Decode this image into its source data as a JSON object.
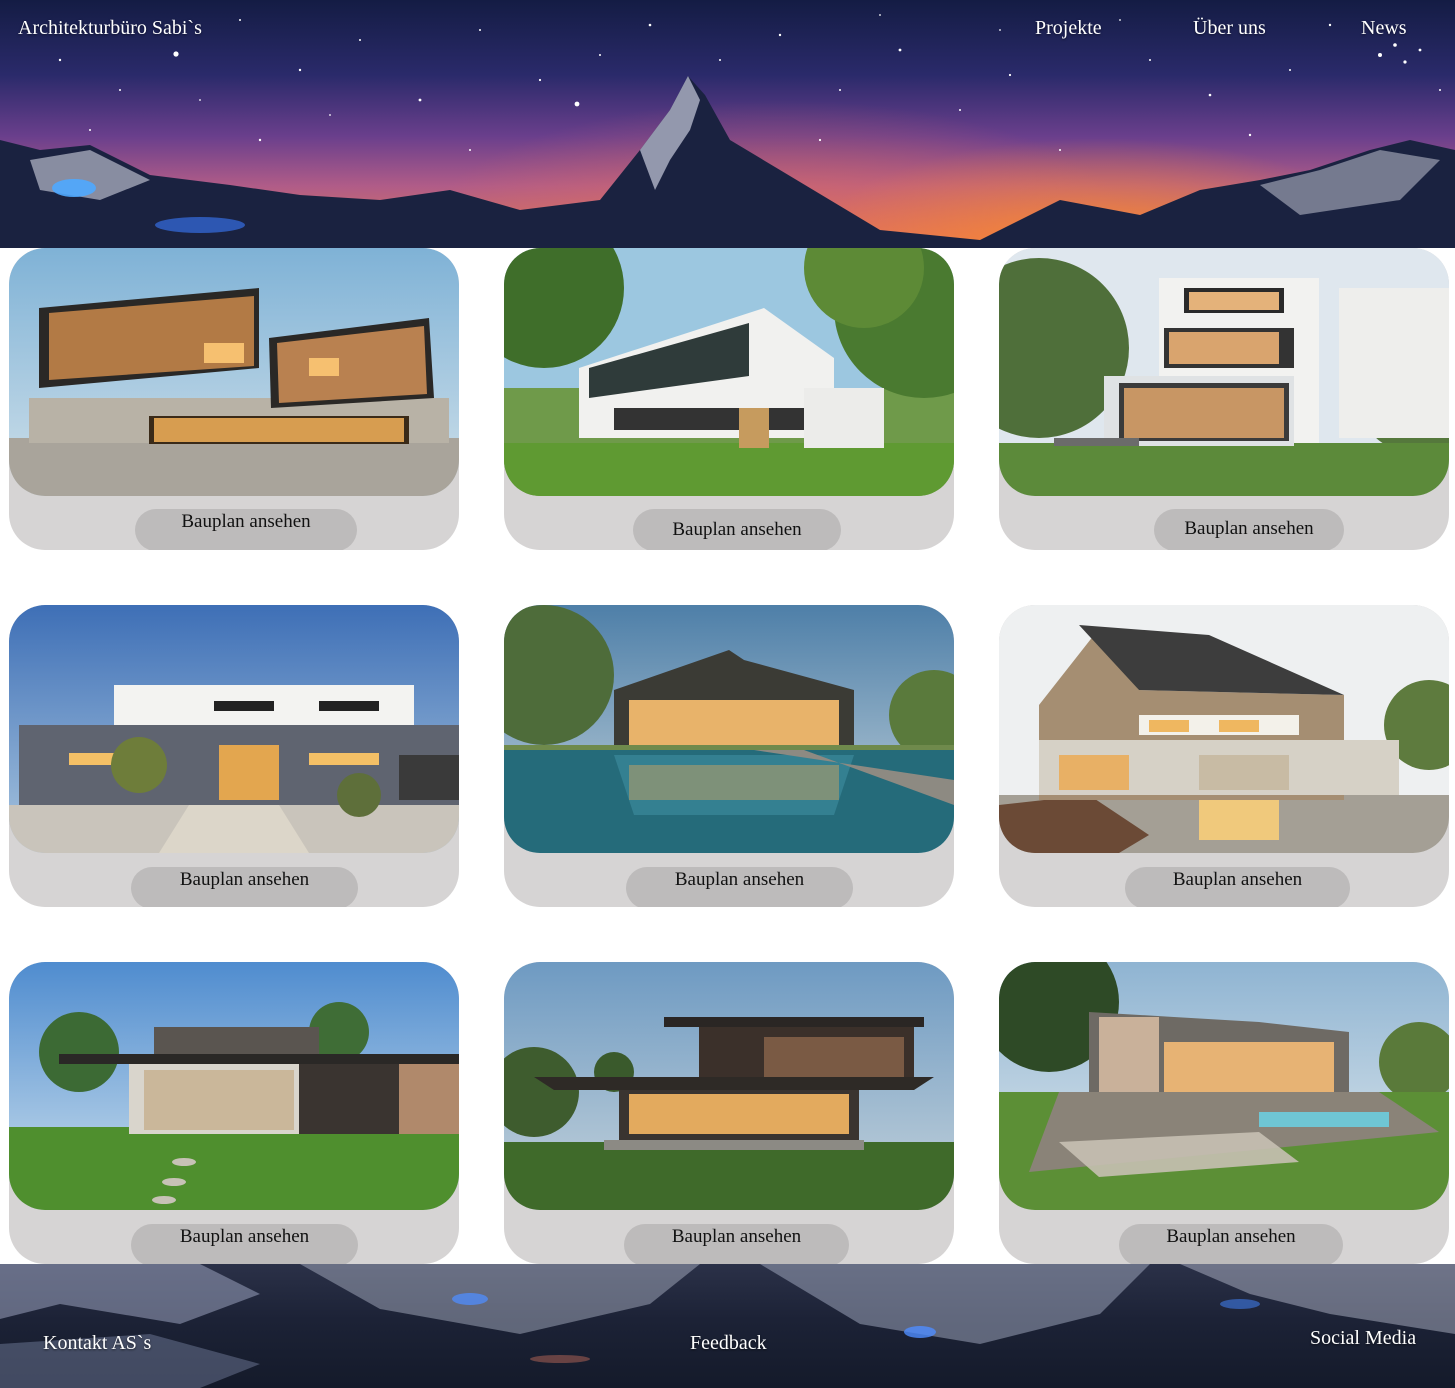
{
  "header": {
    "brand": "Architekturbüro Sabi`s",
    "nav": [
      {
        "label": "Projekte"
      },
      {
        "label": "Über uns"
      },
      {
        "label": "News"
      }
    ]
  },
  "projects": [
    {
      "button_label": "Bauplan ansehen"
    },
    {
      "button_label": "Bauplan ansehen"
    },
    {
      "button_label": "Bauplan ansehen"
    },
    {
      "button_label": "Bauplan ansehen"
    },
    {
      "button_label": "Bauplan ansehen"
    },
    {
      "button_label": "Bauplan ansehen"
    },
    {
      "button_label": "Bauplan ansehen"
    },
    {
      "button_label": "Bauplan ansehen"
    },
    {
      "button_label": "Bauplan ansehen"
    }
  ],
  "footer": {
    "contact": "Kontakt AS`s",
    "feedback": "Feedback",
    "social": "Social Media"
  },
  "colors": {
    "card_bg": "#d6d4d4",
    "button_bg": "#bdbbbb",
    "nav_text": "#ffffff"
  }
}
